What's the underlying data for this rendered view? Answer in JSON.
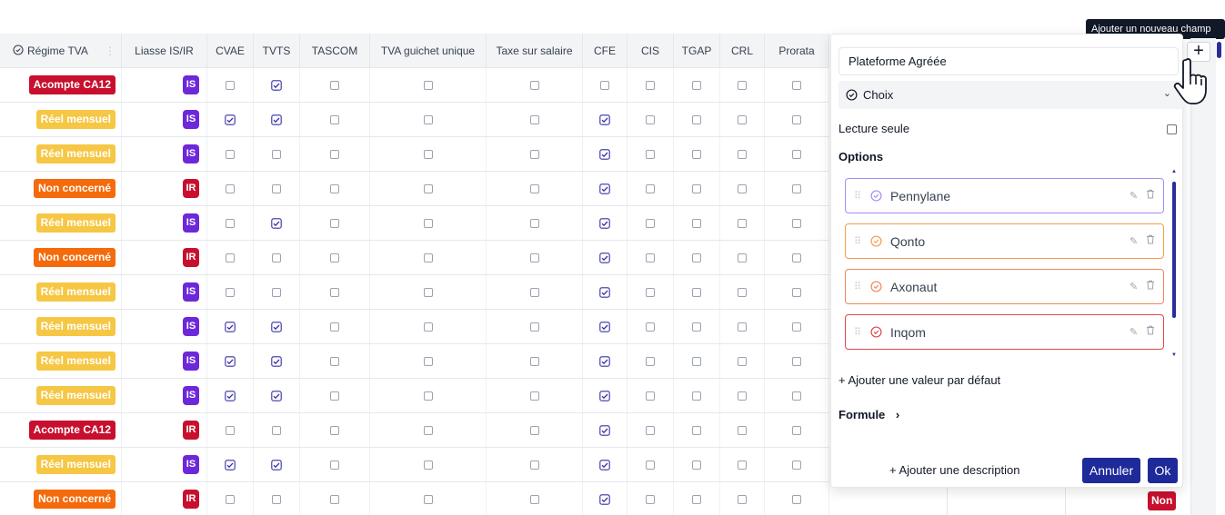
{
  "tooltip": "Ajouter un nouveau champ",
  "add_button_label": "+",
  "columns": [
    "Régime TVA",
    "Liasse IS/IR",
    "CVAE",
    "TVTS",
    "TASCOM",
    "TVA guichet unique",
    "Taxe sur salaire",
    "CFE",
    "CIS",
    "TGAP",
    "CRL",
    "Prorata"
  ],
  "rows": [
    {
      "regime": "Acompte CA12",
      "regime_type": "acompte",
      "liasse": "IS",
      "checks": [
        0,
        1,
        0,
        0,
        0,
        0,
        0,
        0,
        0,
        0
      ]
    },
    {
      "regime": "Réel mensuel",
      "regime_type": "reel",
      "liasse": "IS",
      "checks": [
        1,
        1,
        0,
        0,
        0,
        1,
        0,
        0,
        0,
        0
      ]
    },
    {
      "regime": "Réel mensuel",
      "regime_type": "reel",
      "liasse": "IS",
      "checks": [
        0,
        0,
        0,
        0,
        0,
        1,
        0,
        0,
        0,
        0
      ]
    },
    {
      "regime": "Non concerné",
      "regime_type": "non",
      "liasse": "IR",
      "checks": [
        0,
        0,
        0,
        0,
        0,
        1,
        0,
        0,
        0,
        0
      ]
    },
    {
      "regime": "Réel mensuel",
      "regime_type": "reel",
      "liasse": "IS",
      "checks": [
        0,
        1,
        0,
        0,
        0,
        1,
        0,
        0,
        0,
        0
      ]
    },
    {
      "regime": "Non concerné",
      "regime_type": "non",
      "liasse": "IR",
      "checks": [
        0,
        0,
        0,
        0,
        0,
        1,
        0,
        0,
        0,
        0
      ]
    },
    {
      "regime": "Réel mensuel",
      "regime_type": "reel",
      "liasse": "IS",
      "checks": [
        0,
        0,
        0,
        0,
        0,
        1,
        0,
        0,
        0,
        0
      ]
    },
    {
      "regime": "Réel mensuel",
      "regime_type": "reel",
      "liasse": "IS",
      "checks": [
        1,
        1,
        0,
        0,
        0,
        1,
        0,
        0,
        0,
        0
      ]
    },
    {
      "regime": "Réel mensuel",
      "regime_type": "reel",
      "liasse": "IS",
      "checks": [
        1,
        1,
        0,
        0,
        0,
        1,
        0,
        0,
        0,
        0
      ]
    },
    {
      "regime": "Réel mensuel",
      "regime_type": "reel",
      "liasse": "IS",
      "checks": [
        1,
        1,
        0,
        0,
        0,
        1,
        0,
        0,
        0,
        0
      ]
    },
    {
      "regime": "Acompte CA12",
      "regime_type": "acompte",
      "liasse": "IR",
      "checks": [
        0,
        0,
        0,
        0,
        0,
        1,
        0,
        0,
        0,
        0
      ]
    },
    {
      "regime": "Réel mensuel",
      "regime_type": "reel",
      "liasse": "IS",
      "checks": [
        1,
        1,
        0,
        0,
        0,
        1,
        0,
        0,
        0,
        0
      ]
    },
    {
      "regime": "Non concerné",
      "regime_type": "non",
      "liasse": "IR",
      "checks": [
        0,
        0,
        0,
        0,
        0,
        1,
        0,
        0,
        0,
        0
      ]
    }
  ],
  "panel": {
    "field_name": "Plateforme Agréée",
    "field_type": "Choix",
    "read_only_label": "Lecture seule",
    "options_title": "Options",
    "options": [
      {
        "label": "Pennylane",
        "color": "#a78bfa"
      },
      {
        "label": "Qonto",
        "color": "#f59e4b"
      },
      {
        "label": "Axonaut",
        "color": "#f2865a"
      },
      {
        "label": "Inqom",
        "color": "#e0474c"
      }
    ],
    "add_default": "Ajouter une valeur par défaut",
    "formula": "Formule",
    "add_description": "Ajouter une description",
    "cancel": "Annuler",
    "ok": "Ok"
  },
  "trailing_badge": "Non",
  "colors": {
    "accent": "#1e2a9a",
    "acompte": "#c8102e",
    "reel": "#f6c744",
    "non": "#f56a0a",
    "is": "#6d28d9",
    "ir": "#c8102e"
  }
}
